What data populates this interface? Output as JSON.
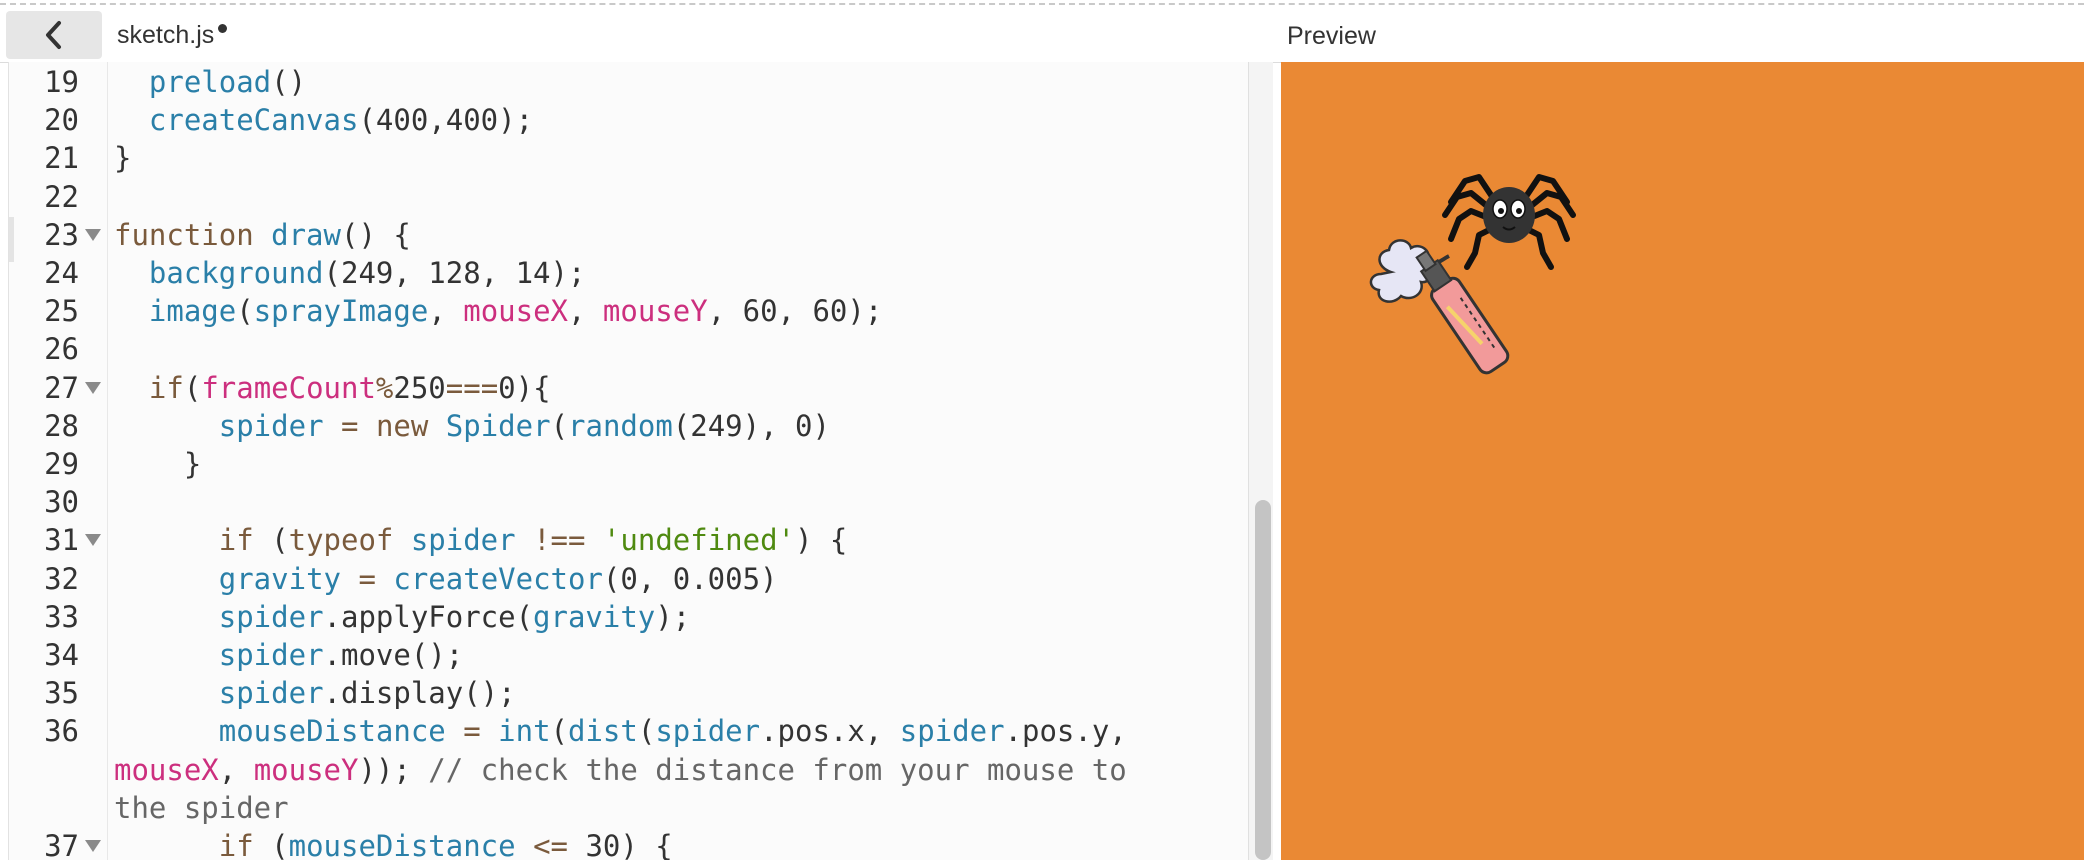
{
  "header": {
    "back_label": "chevron-left",
    "file_name": "sketch.js",
    "preview_label": "Preview"
  },
  "editor": {
    "lines": [
      {
        "num": "19",
        "fold": false,
        "tokens": [
          [
            "pl",
            "  "
          ],
          [
            "fn",
            "preload"
          ],
          [
            "pl",
            "()"
          ]
        ]
      },
      {
        "num": "20",
        "fold": false,
        "tokens": [
          [
            "pl",
            "  "
          ],
          [
            "fn",
            "createCanvas"
          ],
          [
            "pl",
            "(400,400);"
          ]
        ]
      },
      {
        "num": "21",
        "fold": false,
        "tokens": [
          [
            "pl",
            "}"
          ]
        ]
      },
      {
        "num": "22",
        "fold": false,
        "tokens": []
      },
      {
        "num": "23",
        "fold": true,
        "tokens": [
          [
            "kw",
            "function "
          ],
          [
            "fn",
            "draw"
          ],
          [
            "pl",
            "() {"
          ]
        ]
      },
      {
        "num": "24",
        "fold": false,
        "tokens": [
          [
            "pl",
            "  "
          ],
          [
            "fn",
            "background"
          ],
          [
            "pl",
            "(249, 128, 14);"
          ]
        ]
      },
      {
        "num": "25",
        "fold": false,
        "tokens": [
          [
            "pl",
            "  "
          ],
          [
            "fn",
            "image"
          ],
          [
            "pl",
            "("
          ],
          [
            "fn",
            "sprayImage"
          ],
          [
            "pl",
            ", "
          ],
          [
            "var",
            "mouseX"
          ],
          [
            "pl",
            ", "
          ],
          [
            "var",
            "mouseY"
          ],
          [
            "pl",
            ", 60, 60);"
          ]
        ]
      },
      {
        "num": "26",
        "fold": false,
        "tokens": []
      },
      {
        "num": "27",
        "fold": true,
        "tokens": [
          [
            "pl",
            "  "
          ],
          [
            "kw",
            "if"
          ],
          [
            "pl",
            "("
          ],
          [
            "var",
            "frameCount"
          ],
          [
            "kw",
            "%"
          ],
          [
            "pl",
            "250"
          ],
          [
            "kw",
            "==="
          ],
          [
            "pl",
            "0){"
          ]
        ]
      },
      {
        "num": "28",
        "fold": false,
        "tokens": [
          [
            "pl",
            "      "
          ],
          [
            "fn",
            "spider"
          ],
          [
            "pl",
            " "
          ],
          [
            "kw",
            "="
          ],
          [
            "pl",
            " "
          ],
          [
            "kw",
            "new"
          ],
          [
            "pl",
            " "
          ],
          [
            "fn",
            "Spider"
          ],
          [
            "pl",
            "("
          ],
          [
            "fn",
            "random"
          ],
          [
            "pl",
            "(249), 0)"
          ]
        ]
      },
      {
        "num": "29",
        "fold": false,
        "tokens": [
          [
            "pl",
            "    }"
          ]
        ]
      },
      {
        "num": "30",
        "fold": false,
        "tokens": []
      },
      {
        "num": "31",
        "fold": true,
        "tokens": [
          [
            "pl",
            "      "
          ],
          [
            "kw",
            "if"
          ],
          [
            "pl",
            " ("
          ],
          [
            "kw",
            "typeof"
          ],
          [
            "pl",
            " "
          ],
          [
            "fn",
            "spider"
          ],
          [
            "pl",
            " "
          ],
          [
            "kw",
            "!=="
          ],
          [
            "pl",
            " "
          ],
          [
            "str",
            "'undefined'"
          ],
          [
            "pl",
            ") {"
          ]
        ]
      },
      {
        "num": "32",
        "fold": false,
        "tokens": [
          [
            "pl",
            "      "
          ],
          [
            "fn",
            "gravity"
          ],
          [
            "pl",
            " "
          ],
          [
            "kw",
            "="
          ],
          [
            "pl",
            " "
          ],
          [
            "fn",
            "createVector"
          ],
          [
            "pl",
            "(0, 0.005)"
          ]
        ]
      },
      {
        "num": "33",
        "fold": false,
        "tokens": [
          [
            "pl",
            "      "
          ],
          [
            "fn",
            "spider"
          ],
          [
            "pl",
            ".applyForce("
          ],
          [
            "fn",
            "gravity"
          ],
          [
            "pl",
            ");"
          ]
        ]
      },
      {
        "num": "34",
        "fold": false,
        "tokens": [
          [
            "pl",
            "      "
          ],
          [
            "fn",
            "spider"
          ],
          [
            "pl",
            ".move();"
          ]
        ]
      },
      {
        "num": "35",
        "fold": false,
        "tokens": [
          [
            "pl",
            "      "
          ],
          [
            "fn",
            "spider"
          ],
          [
            "pl",
            ".display();"
          ]
        ]
      },
      {
        "num": "36",
        "fold": false,
        "tokens": [
          [
            "pl",
            "      "
          ],
          [
            "fn",
            "mouseDistance"
          ],
          [
            "pl",
            " "
          ],
          [
            "kw",
            "="
          ],
          [
            "pl",
            " "
          ],
          [
            "fn",
            "int"
          ],
          [
            "pl",
            "("
          ],
          [
            "fn",
            "dist"
          ],
          [
            "pl",
            "("
          ],
          [
            "fn",
            "spider"
          ],
          [
            "pl",
            ".pos.x, "
          ],
          [
            "fn",
            "spider"
          ],
          [
            "pl",
            ".pos.y,"
          ]
        ]
      },
      {
        "num": "",
        "fold": false,
        "tokens": [
          [
            "var",
            "mouseX"
          ],
          [
            "pl",
            ", "
          ],
          [
            "var",
            "mouseY"
          ],
          [
            "pl",
            "));"
          ],
          [
            "cm",
            " // check the distance from your mouse to"
          ]
        ]
      },
      {
        "num": "",
        "fold": false,
        "tokens": [
          [
            "cm",
            "the spider"
          ]
        ]
      },
      {
        "num": "37",
        "fold": true,
        "tokens": [
          [
            "pl",
            "      "
          ],
          [
            "kw",
            "if"
          ],
          [
            "pl",
            " ("
          ],
          [
            "fn",
            "mouseDistance"
          ],
          [
            "pl",
            " "
          ],
          [
            "kw",
            "<="
          ],
          [
            "pl",
            " 30) {"
          ]
        ]
      }
    ]
  },
  "preview": {
    "background_color": "#ea8934",
    "sprites": [
      "spider-sprite",
      "spray-bottle-sprite"
    ]
  },
  "colors": {
    "keyword": "#7a5a3c",
    "function": "#2a7fa8",
    "variable": "#cc2f7e",
    "string": "#4f8a10",
    "comment": "#666666"
  }
}
